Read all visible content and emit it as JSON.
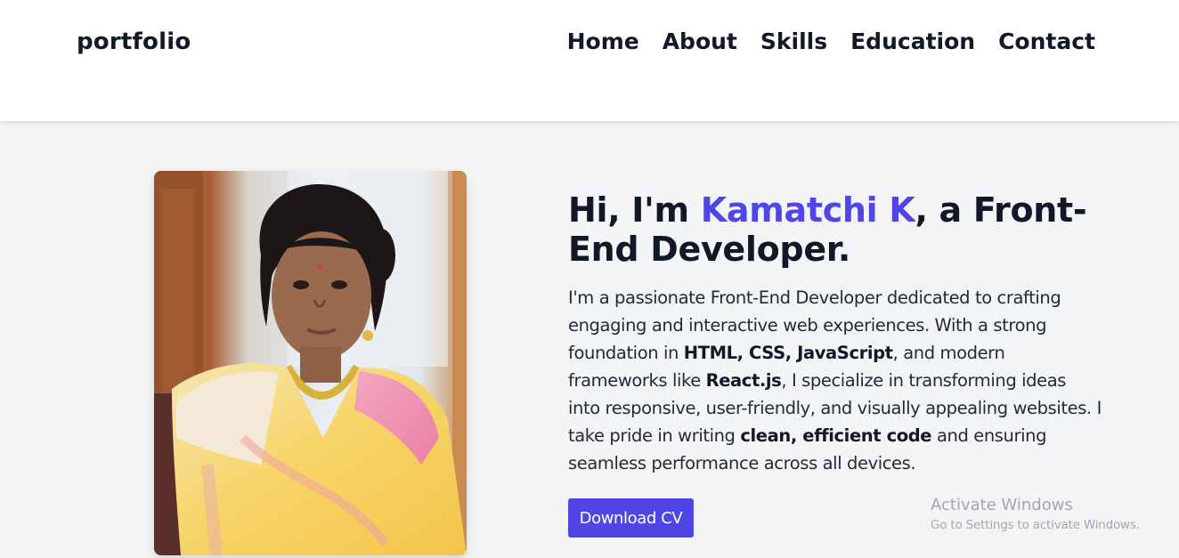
{
  "navbar": {
    "brand": "portfolio",
    "links": [
      "Home",
      "About",
      "Skills",
      "Education",
      "Contact"
    ]
  },
  "hero": {
    "title_prefix": "Hi, I'm ",
    "name": "Kamatchi K",
    "title_suffix": ", a Front-End Developer.",
    "description": {
      "p1": "I'm a passionate Front-End Developer dedicated to crafting engaging and interactive web experiences. With a strong foundation in ",
      "b1": "HTML, CSS, JavaScript",
      "p2": ", and modern frameworks like ",
      "b2": "React.js",
      "p3": ", I specialize in transforming ideas into responsive, user-friendly, and visually appealing websites. I take pride in writing ",
      "b3": "clean, efficient code",
      "p4": " and ensuring seamless performance across all devices."
    },
    "button_label": "Download CV",
    "accent_color": "#4f46e5"
  },
  "watermark": {
    "title": "Activate Windows",
    "subtitle": "Go to Settings to activate Windows."
  }
}
